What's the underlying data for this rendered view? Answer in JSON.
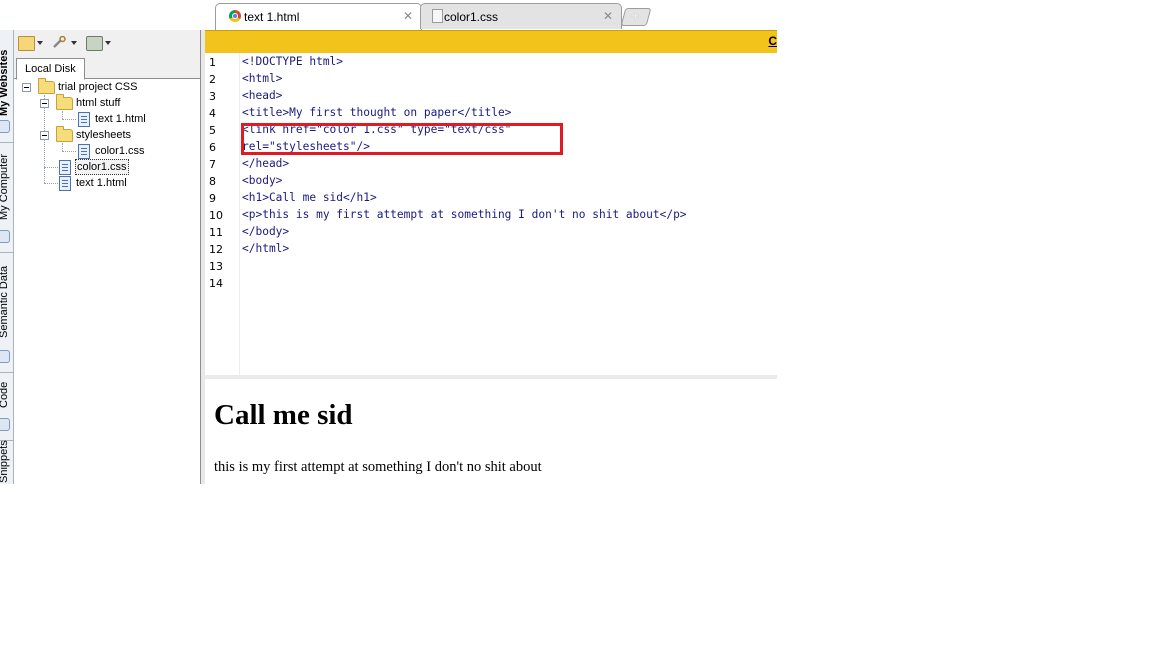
{
  "side_tabs": [
    {
      "label": "My Websites",
      "active": true
    },
    {
      "label": "My Computer",
      "active": false
    },
    {
      "label": "Semantic Data",
      "active": false
    },
    {
      "label": "Code",
      "active": false
    },
    {
      "label": "Snippets",
      "active": false
    }
  ],
  "toolbar": {
    "icons": [
      "open-folder-icon",
      "tools-icon",
      "site-settings-icon"
    ]
  },
  "file_panel": {
    "tab_label": "Local Disk",
    "tree": [
      {
        "label": "trial project CSS",
        "type": "folder",
        "depth": 0
      },
      {
        "label": "html stuff",
        "type": "folder",
        "depth": 1
      },
      {
        "label": "text 1.html",
        "type": "file",
        "depth": 2
      },
      {
        "label": "stylesheets",
        "type": "folder",
        "depth": 1
      },
      {
        "label": "color1.css",
        "type": "file",
        "depth": 2
      },
      {
        "label": "color1.css",
        "type": "file",
        "depth": 1,
        "selected": true
      },
      {
        "label": "text 1.html",
        "type": "file",
        "depth": 1
      }
    ]
  },
  "doc_tabs": [
    {
      "label": "text 1.html",
      "icon": "chrome-icon",
      "active": true
    },
    {
      "label": "color1.css",
      "icon": "css-file-icon",
      "active": false
    }
  ],
  "info_bar": {
    "link_text": "C",
    "color": "#f2c31b"
  },
  "editor": {
    "line_numbers": [
      "1",
      "2",
      "3",
      "4",
      "5",
      "6",
      "7",
      "8",
      "9",
      "10",
      "11",
      "12",
      "13",
      "14"
    ],
    "lines": [
      "<!DOCTYPE html>",
      "<html>",
      "<head>",
      "<title>My first thought on paper</title>",
      "<link href=\"color 1.css\" type=\"text/css\"",
      "rel=\"stylesheets\"/>",
      "</head>",
      "<body>",
      "<h1>Call me sid</h1>",
      "<p>this is my first attempt at something I don't no shit about</p>",
      "</body>",
      "</html>",
      "",
      ""
    ],
    "highlight_color": "#e01b24"
  },
  "preview": {
    "heading": "Call me sid",
    "paragraph": "this is my first attempt at something I don't no shit about"
  }
}
